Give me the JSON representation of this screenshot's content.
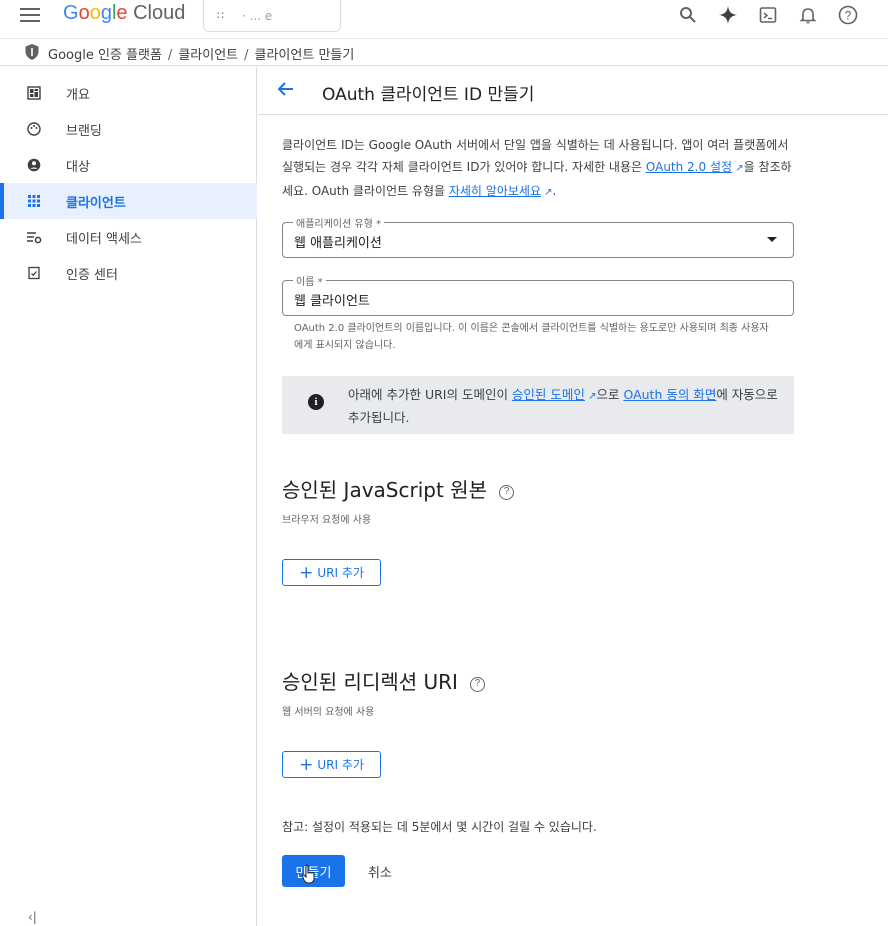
{
  "header": {
    "logo": {
      "google": "Google",
      "cloud": "Cloud"
    },
    "project_name": "· ... e",
    "icons": [
      "search-icon",
      "gemini-icon",
      "terminal-icon",
      "bell-icon",
      "help-icon"
    ]
  },
  "breadcrumb": {
    "items": [
      "Google 인증 플랫폼",
      "클라이언트",
      "클라이언트 만들기"
    ],
    "separator": "/"
  },
  "sidebar": {
    "items": [
      {
        "label": "개요",
        "icon": "dashboard-icon"
      },
      {
        "label": "브랜딩",
        "icon": "palette-icon"
      },
      {
        "label": "대상",
        "icon": "person-icon"
      },
      {
        "label": "클라이언트",
        "icon": "grid-icon",
        "active": true
      },
      {
        "label": "데이터 액세스",
        "icon": "data-settings-icon"
      },
      {
        "label": "인증 센터",
        "icon": "verified-icon"
      }
    ],
    "collapse_glyph": "‹|"
  },
  "page": {
    "title": "OAuth 클라이언트 ID 만들기",
    "intro": {
      "part1": "클라이언트 ID는 Google OAuth 서버에서 단일 앱을 식별하는 데 사용됩니다. 앱이 여러 플랫폼에서 실행되는 경우 각각 자체 클라이언트 ID가 있어야 합니다. 자세한 내용은 ",
      "link1": "OAuth 2.0 설정",
      "part2": "을 참조하세요. OAuth 클라이언트 유형을 ",
      "link2": "자세히 알아보세요",
      "part3": "."
    },
    "app_type": {
      "label": "애플리케이션 유형 *",
      "value": "웹 애플리케이션"
    },
    "name": {
      "label": "이름 *",
      "value": "웹 클라이언트"
    },
    "name_hint": "OAuth 2.0 클라이언트의 이름입니다. 이 이름은 콘솔에서 클라이언트를 식별하는 용도로만 사용되며 최종 사용자에게 표시되지 않습니다.",
    "notice": {
      "part1": "아래에 추가한 URI의 도메인이 ",
      "link1": "승인된 도메인",
      "part2": "으로 ",
      "link2": "OAuth 동의 화면",
      "part3": "에 자동으로 추가됩니다."
    },
    "js_origins": {
      "title": "승인된 JavaScript 원본",
      "subtitle": "브라우저 요청에 사용",
      "button": "URI 추가"
    },
    "redirect_uris": {
      "title": "승인된 리디렉션 URI",
      "subtitle": "웹 서버의 요청에 사용",
      "button": "URI 추가"
    },
    "note": "참고: 설정이 적용되는 데 5분에서 몇 시간이 걸릴 수 있습니다.",
    "create_button": "만들기",
    "cancel_button": "취소"
  },
  "colors": {
    "accent": "#1a73e8",
    "active_bg": "#e8f0fe",
    "notice_bg": "#e8eaed"
  }
}
